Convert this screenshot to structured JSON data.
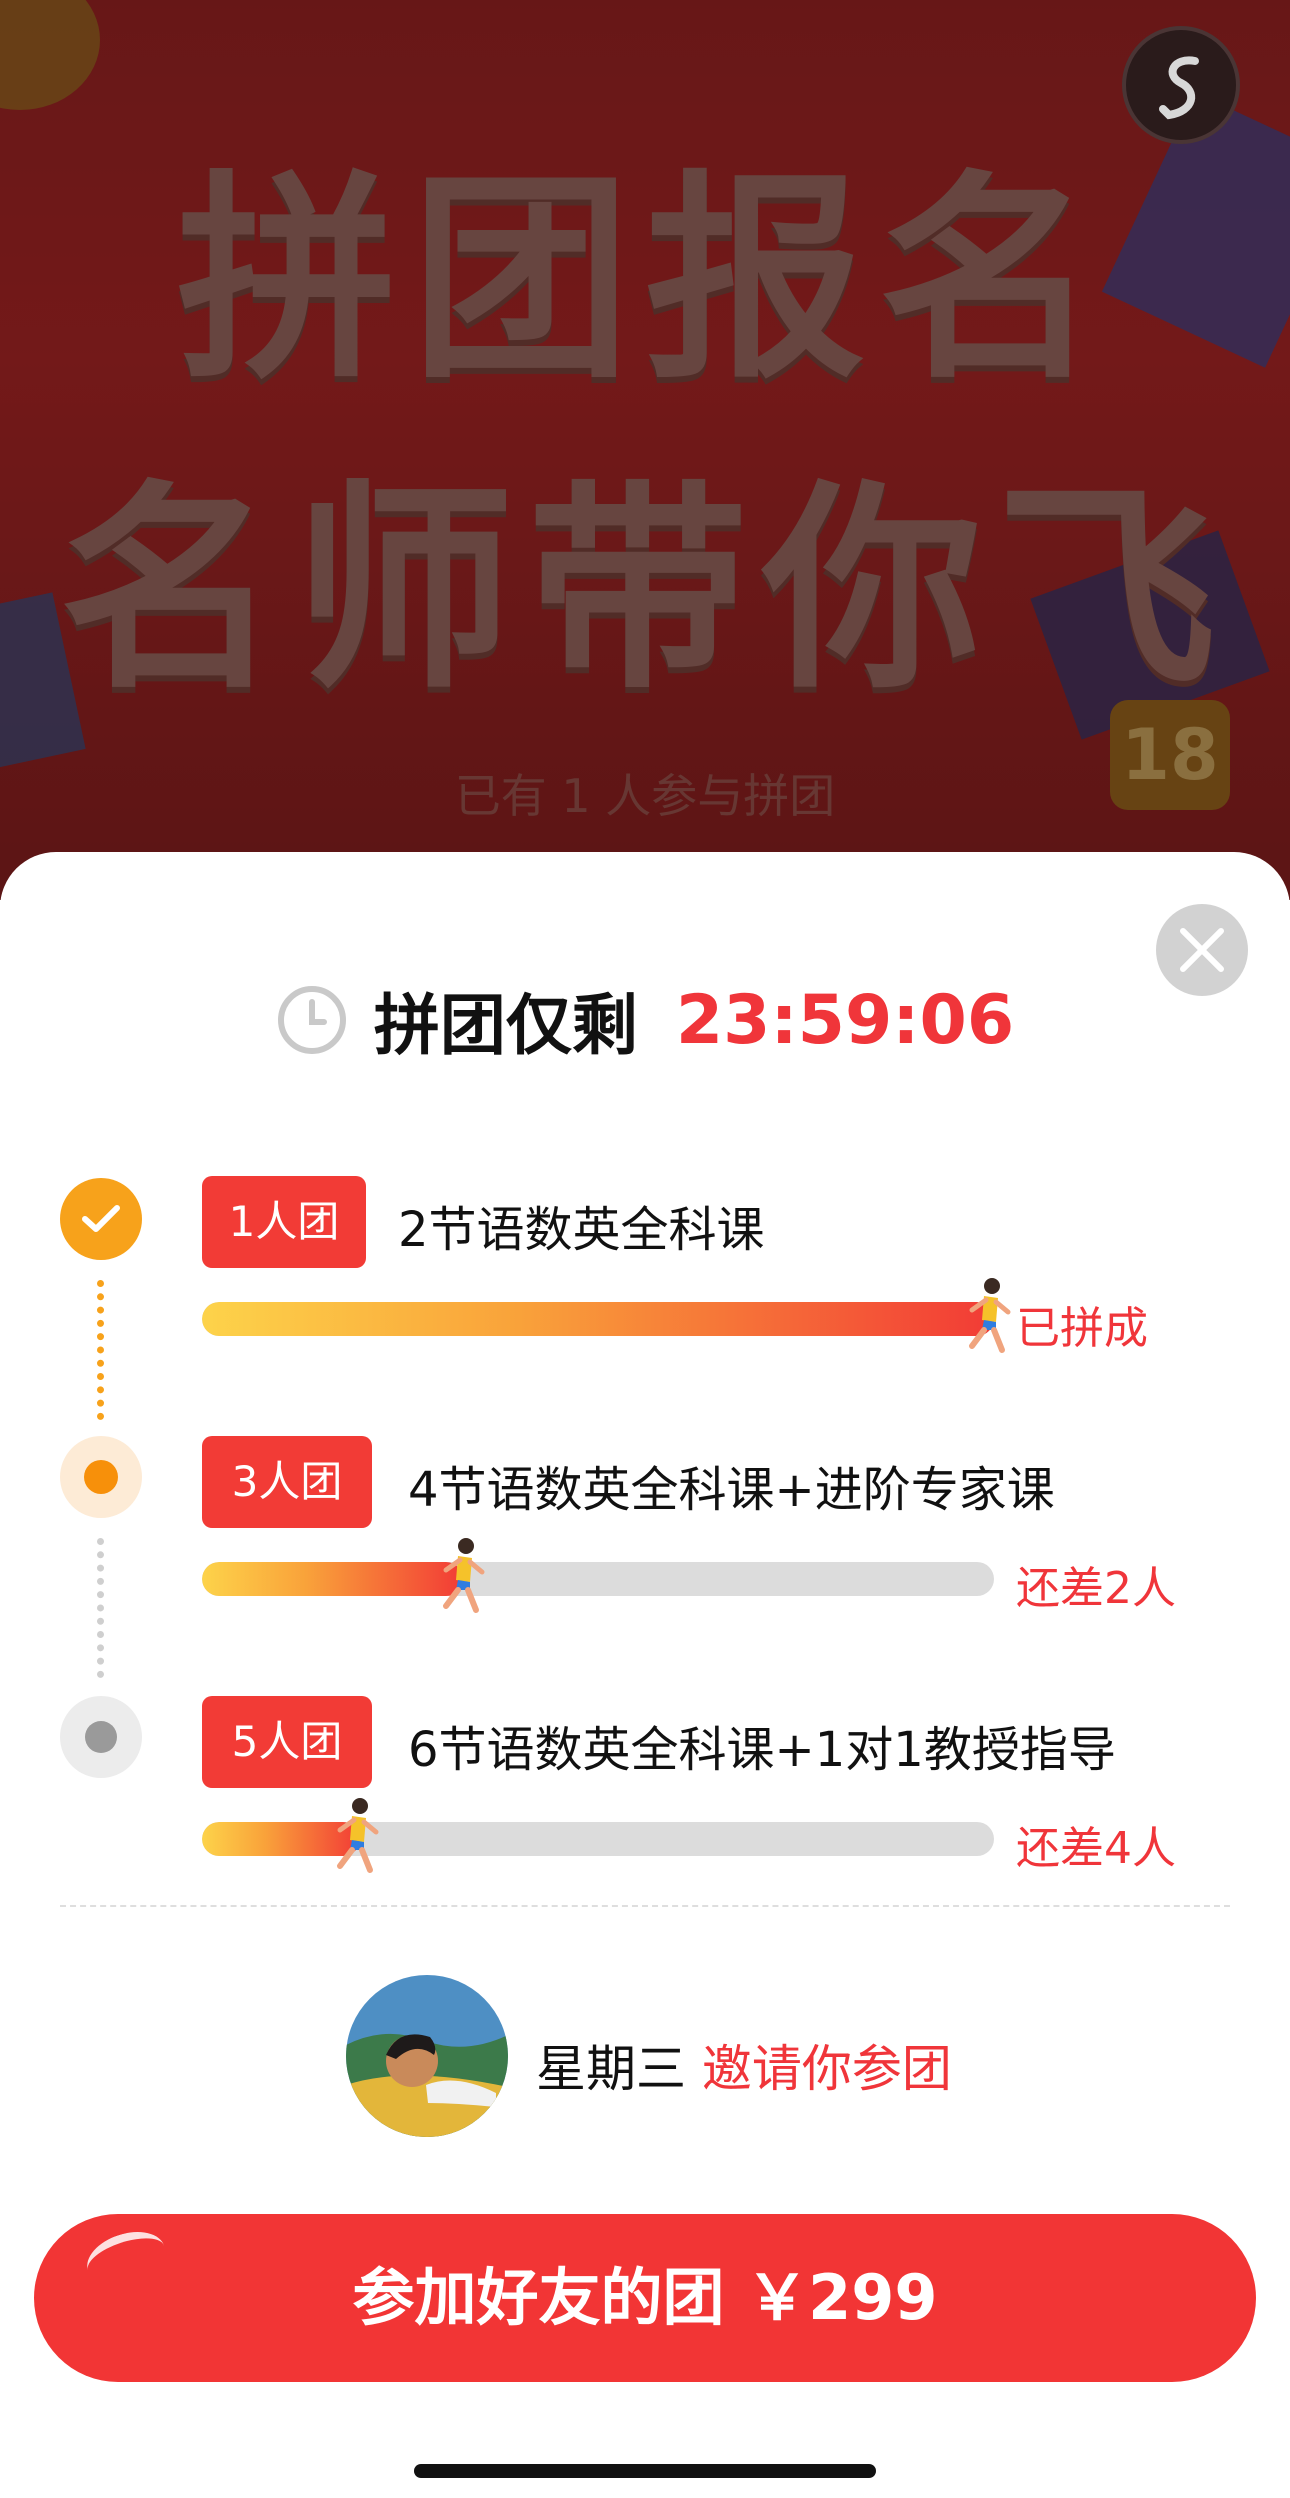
{
  "banner": {
    "title_line_1": "拼团报名",
    "title_line_2": "名师带你飞",
    "participants_text": "已有 1 人参与拼团",
    "share_badge": "18"
  },
  "timer": {
    "label": "拼团仅剩",
    "countdown": "23:59:06",
    "icon": "clock-icon"
  },
  "tiers": [
    {
      "tag": "1人团",
      "description": "2节语数英全科课",
      "status": "已拼成",
      "progress": 1.0,
      "state": "completed"
    },
    {
      "tag": "3人团",
      "description": "4节语数英全科课+进阶专家课",
      "status": "还差2人",
      "progress": 0.33,
      "state": "current"
    },
    {
      "tag": "5人团",
      "description": "6节语数英全科课+1对1教授指导",
      "status": "还差4人",
      "progress": 0.2,
      "state": "pending"
    }
  ],
  "invite": {
    "name": "星期三",
    "message": "邀请你参团"
  },
  "join_button": {
    "label": "参加好友的团 ￥299"
  },
  "colors": {
    "accent_red": "#f23535",
    "accent_orange": "#f7a21b",
    "track_gray": "#dcdcdc"
  }
}
